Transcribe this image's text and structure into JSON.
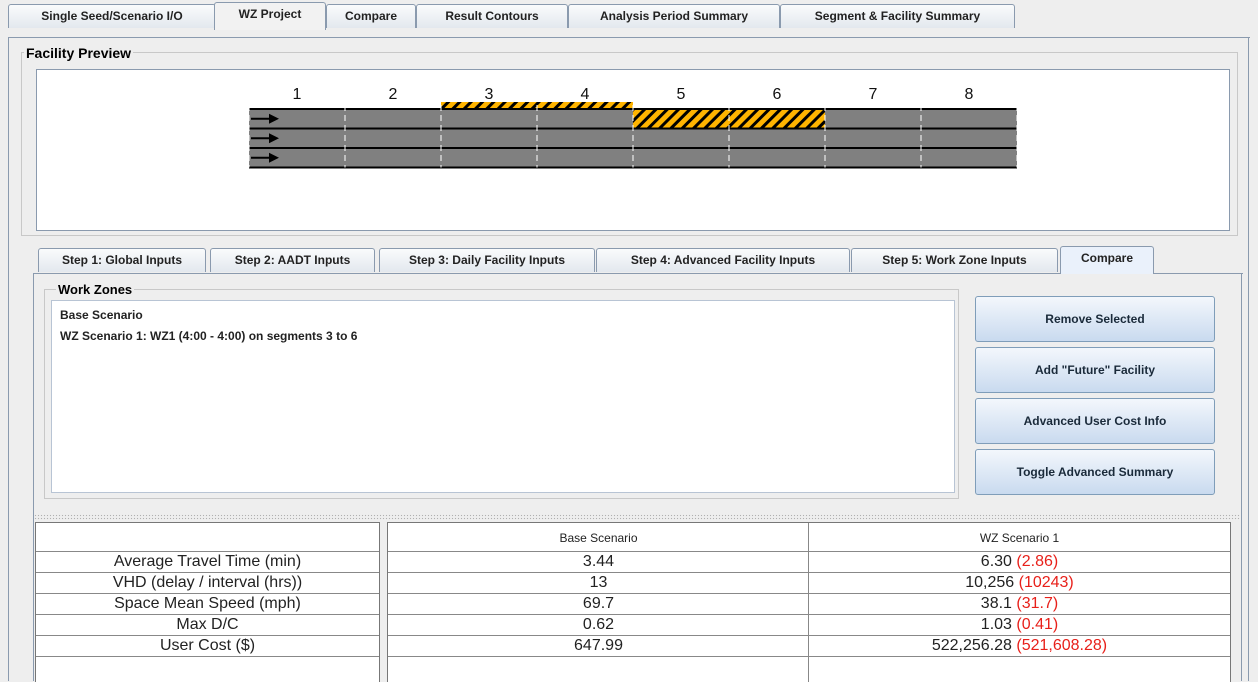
{
  "top_tabs": [
    {
      "label": "Single Seed/Scenario I/O",
      "active": false
    },
    {
      "label": "WZ Project",
      "active": true
    },
    {
      "label": "Compare",
      "active": false
    },
    {
      "label": "Result Contours",
      "active": false
    },
    {
      "label": "Analysis Period Summary",
      "active": false
    },
    {
      "label": "Segment & Facility Summary",
      "active": false
    }
  ],
  "facility_preview": {
    "title": "Facility Preview",
    "segments": [
      "1",
      "2",
      "3",
      "4",
      "5",
      "6",
      "7",
      "8"
    ],
    "lanes": 3,
    "work_zone_segments": [
      3,
      4,
      5,
      6
    ],
    "colors": {
      "road": "#808080",
      "hatch_yellow": "#ffb400",
      "hatch_black": "#000000"
    }
  },
  "step_tabs": [
    {
      "label": "Step 1: Global Inputs",
      "active": false
    },
    {
      "label": "Step 2: AADT Inputs",
      "active": false
    },
    {
      "label": "Step 3: Daily Facility Inputs",
      "active": false
    },
    {
      "label": "Step 4: Advanced Facility Inputs",
      "active": false
    },
    {
      "label": "Step 5: Work Zone Inputs",
      "active": false
    },
    {
      "label": "Compare",
      "active": true
    }
  ],
  "work_zones": {
    "title": "Work Zones",
    "items": [
      {
        "name": "Base Scenario",
        "detail": ""
      },
      {
        "name": "WZ Scenario 1:",
        "detail": " WZ1 (4:00 - 4:00) on segments 3 to 6"
      }
    ]
  },
  "buttons": {
    "remove_selected": "Remove Selected",
    "add_future": "Add \"Future\" Facility",
    "advanced_user_cost": "Advanced User Cost Info",
    "toggle_summary": "Toggle Advanced Summary"
  },
  "results": {
    "columns": [
      "Base Scenario",
      "WZ Scenario 1"
    ],
    "rows": [
      {
        "label": "Average Travel Time (min)",
        "base": "3.44",
        "wz": "6.30",
        "diff": "(2.86)"
      },
      {
        "label": "VHD (delay / interval (hrs))",
        "base": "13",
        "wz": "10,256",
        "diff": "(10243)"
      },
      {
        "label": "Space Mean Speed (mph)",
        "base": "69.7",
        "wz": "38.1",
        "diff": "(31.7)"
      },
      {
        "label": "Max D/C",
        "base": "0.62",
        "wz": "1.03",
        "diff": "(0.41)"
      },
      {
        "label": "User Cost ($)",
        "base": "647.99",
        "wz": "522,256.28",
        "diff": "(521,608.28)"
      }
    ],
    "colors": {
      "diff": "#e8201a"
    }
  }
}
